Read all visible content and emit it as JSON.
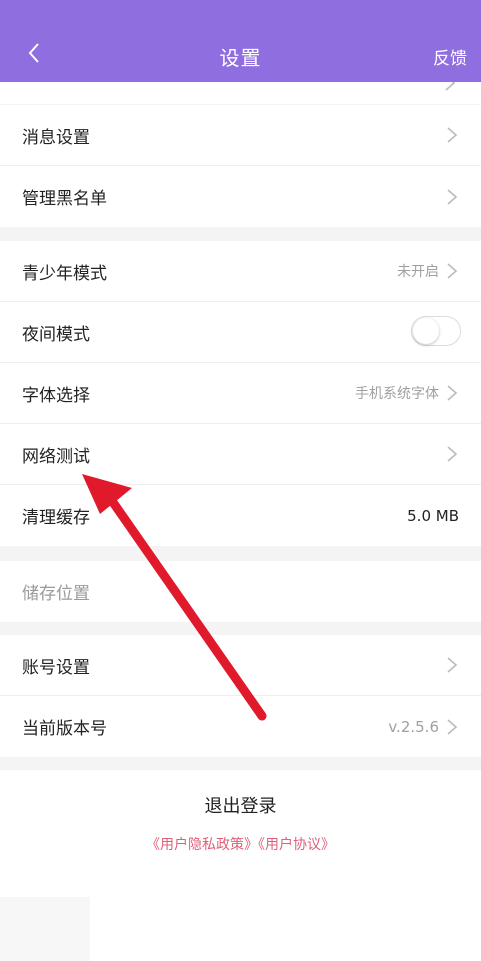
{
  "header": {
    "title": "设置",
    "feedback": "反馈",
    "background": "#8f6ee0"
  },
  "group1": [
    {
      "label": "消息设置"
    },
    {
      "label": "管理黑名单"
    }
  ],
  "group2": [
    {
      "label": "青少年模式",
      "value": "未开启"
    },
    {
      "label": "夜间模式",
      "toggle": false
    },
    {
      "label": "字体选择",
      "value": "手机系统字体"
    },
    {
      "label": "网络测试"
    },
    {
      "label": "清理缓存",
      "value": "5.0 MB"
    }
  ],
  "group3": [
    {
      "label": "储存位置"
    }
  ],
  "group4": [
    {
      "label": "账号设置"
    },
    {
      "label": "当前版本号",
      "value": "v.2.5.6"
    }
  ],
  "logout": "退出登录",
  "links": {
    "privacy": "《用户隐私政策》",
    "agreement": "《用户协议》",
    "color": "#e0607a"
  },
  "annotation": {
    "color": "#e0192b"
  }
}
